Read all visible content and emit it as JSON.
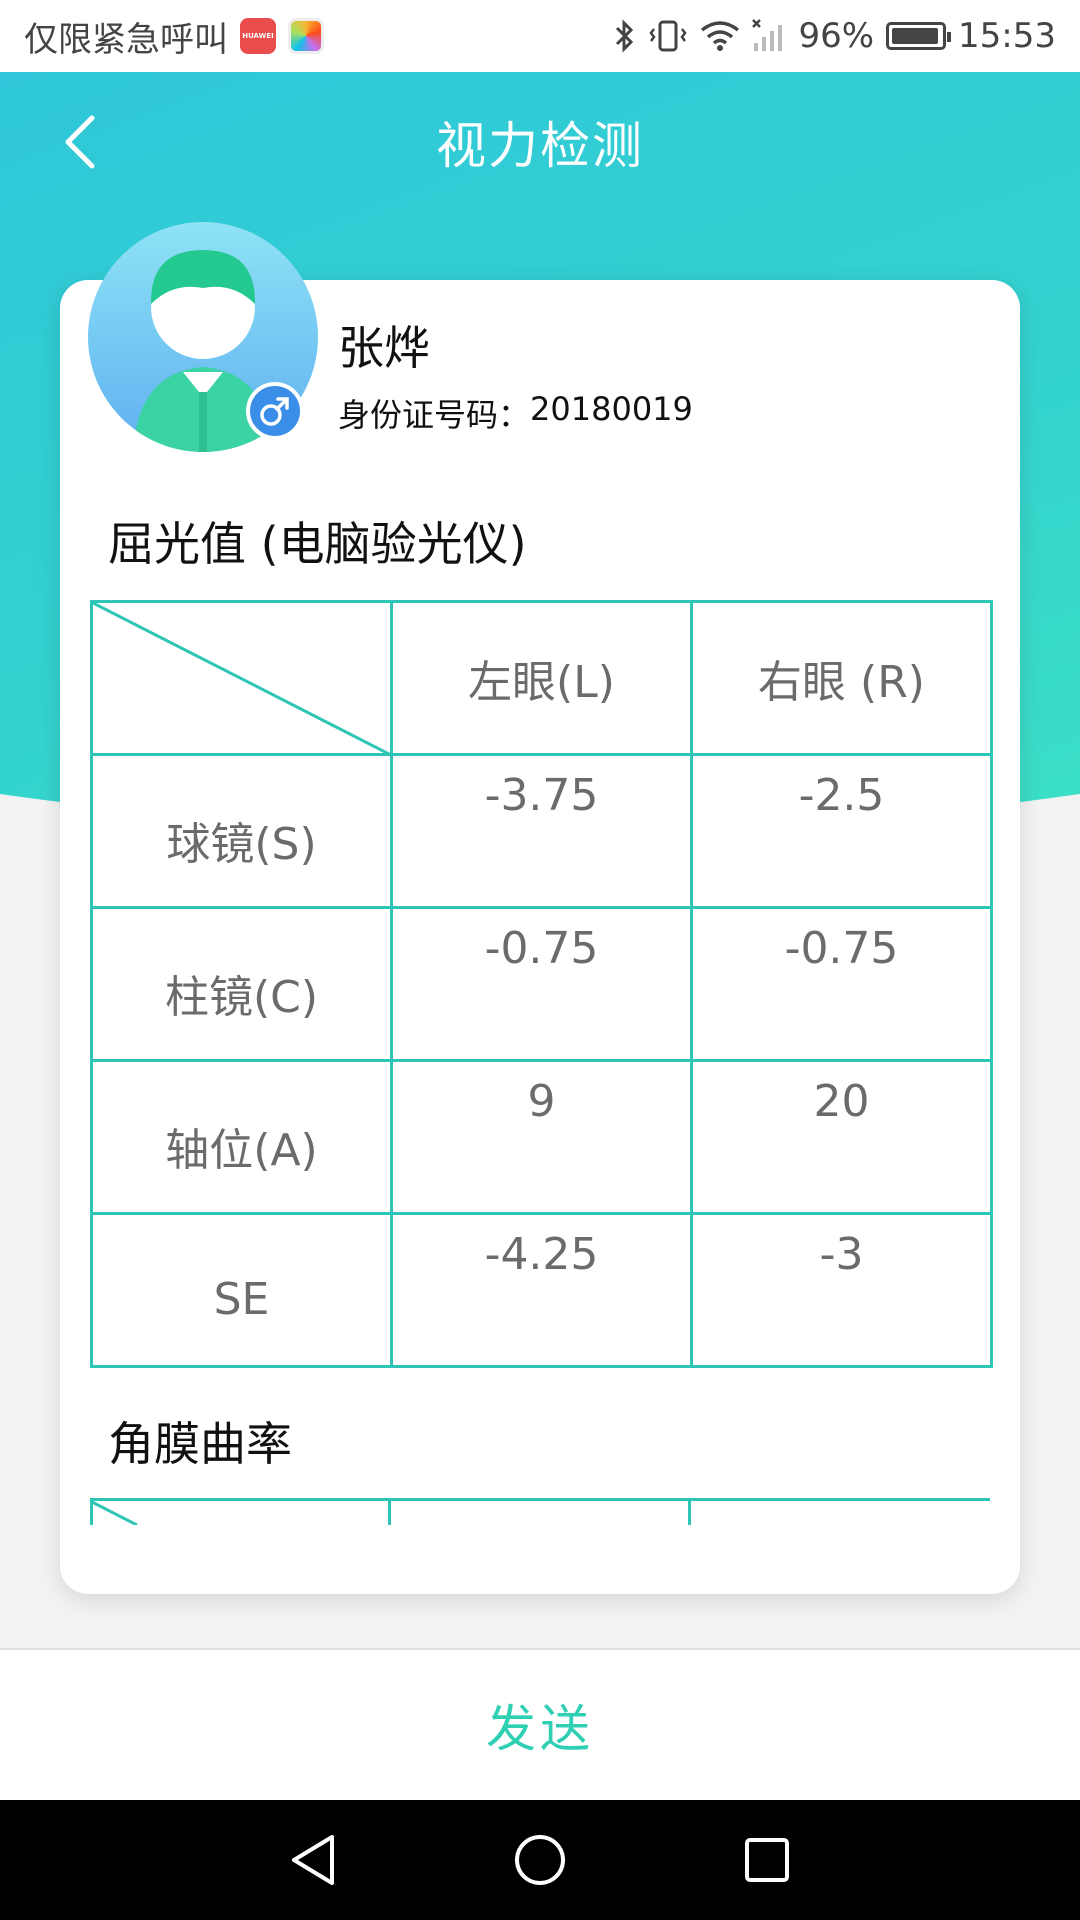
{
  "status_bar": {
    "carrier_text": "仅限紧急呼叫",
    "huawei_badge": "HUAWEI",
    "battery_percent": "96%",
    "battery_level": 0.96,
    "time": "15:53"
  },
  "header": {
    "title": "视力检测"
  },
  "profile": {
    "name": "张烨",
    "id_label": "身份证号码：",
    "id_value": "20180019"
  },
  "sections": {
    "refraction_title": "屈光值 (电脑验光仪)",
    "cornea_title": "角膜曲率"
  },
  "refraction_table": {
    "columns": [
      "左眼(L)",
      "右眼 (R)"
    ],
    "rows": [
      {
        "label": "球镜(S)",
        "left": "-3.75",
        "right": "-2.5"
      },
      {
        "label": "柱镜(C)",
        "left": "-0.75",
        "right": "-0.75"
      },
      {
        "label": "轴位(A)",
        "left": "9",
        "right": "20"
      },
      {
        "label": "SE",
        "left": "-4.25",
        "right": "-3"
      }
    ]
  },
  "actions": {
    "send_label": "发送"
  },
  "colors": {
    "accent": "#2ec4b6",
    "send_text": "#2ecfb3",
    "header_gradient_start": "#2fc7d9",
    "header_gradient_end": "#3cdfc6"
  },
  "icons": {
    "back": "chevron-left-icon",
    "gender": "male-icon",
    "nav_back": "triangle-back-icon",
    "nav_home": "circle-home-icon",
    "nav_recents": "square-recents-icon"
  }
}
